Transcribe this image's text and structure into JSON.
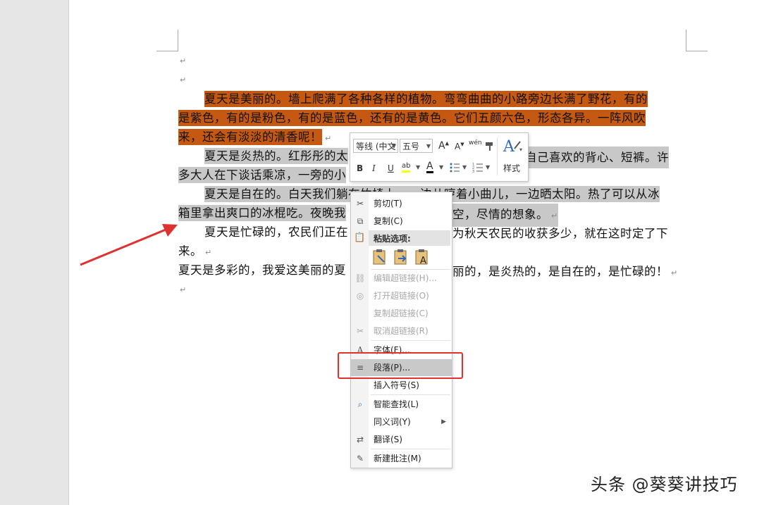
{
  "document": {
    "paragraphs": [
      {
        "lines": [
          "夏天是美丽的。墙上爬满了各种各样的植物。弯弯曲曲的小路旁边长满了野花，有的",
          "是紫色，有的是粉色，有的是蓝色，还有的是黄色。它们五颜六色，形态各异。一阵风吹",
          "来，还会有淡淡的清香呢！"
        ]
      },
      {
        "lines": [
          "夏天是炎热的。红彤彤的太",
          "自己喜欢的背心、短裤。许",
          "多大人在下谈话乘凉，一旁的小"
        ]
      },
      {
        "lines": [
          "夏天是自在的。白天我们躺在竹椅上，一边儿哼着小曲儿，一边晒太阳。热了可以从冰",
          "箱里拿出爽口的冰棍吃。夜晚我",
          "空，尽情的想象。"
        ]
      },
      {
        "lines": [
          "夏天是忙碌的，农民们正在",
          "为秋天农民的收获多少，就在这时定了下",
          "来。"
        ]
      },
      {
        "lines": [
          "夏天是多彩的，我爱这美丽的夏",
          "丽的，是炎热的，是自在的，是忙碌的！"
        ]
      }
    ]
  },
  "mini_toolbar": {
    "font_name": "等线 (中文",
    "font_size": "五号",
    "grow_font": "A",
    "shrink_font": "A",
    "phonetic": "wén",
    "bold": "B",
    "italic": "I",
    "underline": "U",
    "highlight": "ab",
    "font_color": "A",
    "styles_label": "样式"
  },
  "context_menu": {
    "cut": "剪切(T)",
    "copy": "复制(C)",
    "paste_options": "粘贴选项:",
    "edit_hyperlink": "编辑超链接(H)...",
    "open_hyperlink": "打开超链接(O)",
    "copy_hyperlink": "复制超链接(C)",
    "remove_hyperlink": "取消超链接(R)",
    "font": "字体(F)...",
    "paragraph": "段落(P)...",
    "insert_symbol": "插入符号(S)",
    "smart_lookup": "智能查找(L)",
    "synonyms": "同义词(Y)",
    "translate": "翻译(S)",
    "new_comment": "新建批注(M)"
  },
  "watermark": "头条 @葵葵讲技巧",
  "colors": {
    "selection_orange": "#c65911",
    "selection_gray": "#c8c8c8",
    "annotation_red": "#e03030"
  }
}
